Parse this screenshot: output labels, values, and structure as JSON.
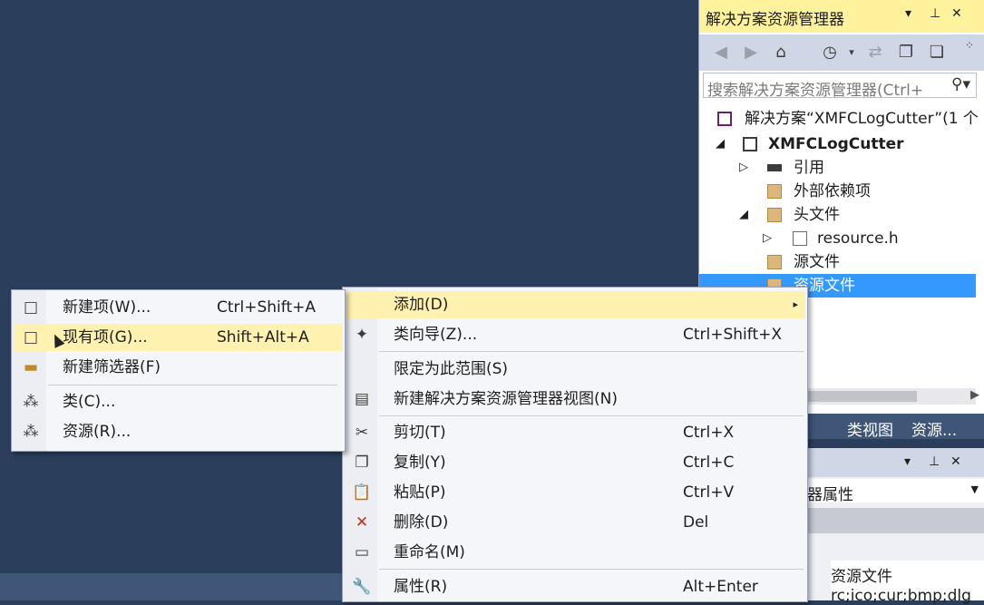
{
  "solution_explorer": {
    "title": "解决方案资源管理器",
    "title_dropdown": "▾",
    "title_pin": "⊥",
    "title_close": "✕",
    "search_placeholder": "搜索解决方案资源管理器(Ctrl+",
    "tree": [
      {
        "text": "解决方案“XMFCLogCutter”(1 个",
        "icon": "solution-icon",
        "arrow": ""
      },
      {
        "text": "XMFCLogCutter",
        "icon": "project-icon",
        "arrow": "◢"
      },
      {
        "text": "引用",
        "icon": "references-icon",
        "arrow": "▷"
      },
      {
        "text": "外部依赖项",
        "icon": "external-deps-icon",
        "arrow": ""
      },
      {
        "text": "头文件",
        "icon": "folder-icon",
        "arrow": "◢"
      },
      {
        "text": "resource.h",
        "icon": "header-file-icon",
        "arrow": "▷"
      },
      {
        "text": "源文件",
        "icon": "folder-icon",
        "arrow": ""
      },
      {
        "text": "资源文件",
        "icon": "folder-icon",
        "arrow": ""
      }
    ],
    "selected_index": 7
  },
  "tab_strip": {
    "tabs": [
      "类视图",
      "资源..."
    ]
  },
  "properties": {
    "combo_text": "器属性",
    "value_1": "资源文件",
    "value_2": "rc;ico;cur;bmp;dlg"
  },
  "context_menu": {
    "items": [
      {
        "label": "添加(D)",
        "shortcut": "",
        "icon": "",
        "submenu": "▸",
        "highlighted": true
      },
      {
        "label": "类向导(Z)...",
        "shortcut": "Ctrl+Shift+X",
        "icon": "class-wizard-icon"
      },
      {
        "label": "限定为此范围(S)",
        "shortcut": "",
        "icon": ""
      },
      {
        "label": "新建解决方案资源管理器视图(N)",
        "shortcut": "",
        "icon": "new-view-icon"
      },
      {
        "label": "剪切(T)",
        "shortcut": "Ctrl+X",
        "icon": "cut-icon"
      },
      {
        "label": "复制(Y)",
        "shortcut": "Ctrl+C",
        "icon": "copy-icon"
      },
      {
        "label": "粘贴(P)",
        "shortcut": "Ctrl+V",
        "icon": "paste-icon"
      },
      {
        "label": "删除(D)",
        "shortcut": "Del",
        "icon": "delete-icon"
      },
      {
        "label": "重命名(M)",
        "shortcut": "",
        "icon": "rename-icon"
      },
      {
        "label": "属性(R)",
        "shortcut": "Alt+Enter",
        "icon": "properties-icon"
      }
    ]
  },
  "add_submenu": {
    "items": [
      {
        "label": "新建项(W)...",
        "shortcut": "Ctrl+Shift+A",
        "icon": "new-item-icon"
      },
      {
        "label": "现有项(G)...",
        "shortcut": "Shift+Alt+A",
        "icon": "existing-item-icon",
        "highlighted": true
      },
      {
        "label": "新建筛选器(F)",
        "shortcut": "",
        "icon": "new-filter-icon"
      },
      {
        "label": "类(C)...",
        "shortcut": "",
        "icon": "class-icon"
      },
      {
        "label": "资源(R)...",
        "shortcut": "",
        "icon": "resource-icon"
      }
    ]
  },
  "colors": {
    "background": "#2b3e5c",
    "title_active": "#fff29d",
    "selection": "#3399ff",
    "menu_highlight": "#fff1b0"
  }
}
